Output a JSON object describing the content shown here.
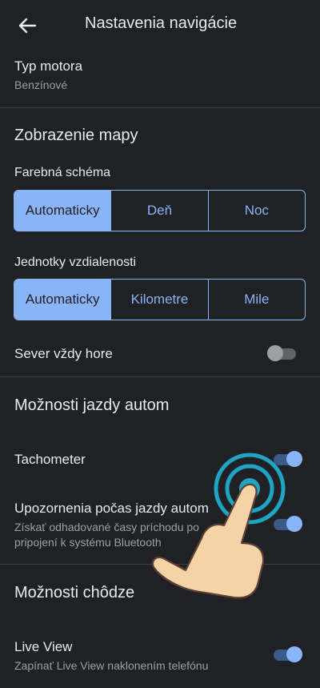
{
  "header": {
    "title": "Nastavenia navigácie",
    "back_icon": "arrow-back-icon"
  },
  "engine": {
    "label": "Typ motora",
    "value": "Benzínové"
  },
  "map_display": {
    "section_title": "Zobrazenie mapy",
    "color_scheme": {
      "label": "Farebná schéma",
      "options": [
        "Automaticky",
        "Deň",
        "Noc"
      ],
      "selected": "Automaticky"
    },
    "units": {
      "label": "Jednotky vzdialenosti",
      "options": [
        "Automaticky",
        "Kilometre",
        "Mile"
      ],
      "selected": "Automaticky"
    },
    "north_up": {
      "label": "Sever vždy hore",
      "enabled": false
    }
  },
  "driving": {
    "section_title": "Možnosti jazdy autom",
    "speedometer": {
      "label": "Tachometer",
      "enabled": true
    },
    "notifications": {
      "label": "Upozornenia počas jazdy autom",
      "desc_line1": "Získať odhadované časy príchodu po",
      "desc_line2": "pripojení k systému Bluetooth",
      "enabled": true
    }
  },
  "walking": {
    "section_title": "Možnosti chôdze",
    "live_view": {
      "label": "Live View",
      "desc": "Zapínať Live View naklonením telefónu",
      "enabled": true
    }
  },
  "colors": {
    "accent": "#8ab4f8",
    "background": "#202124",
    "text": "#e8eaed",
    "secondary_text": "#9aa0a6",
    "divider": "#3c4043"
  }
}
